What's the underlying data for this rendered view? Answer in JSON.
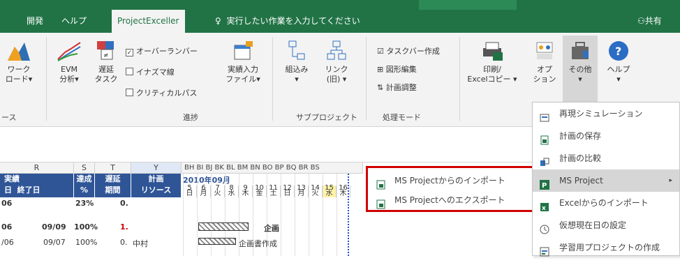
{
  "tabs": [
    "開発",
    "ヘルプ",
    "ProjectExceller"
  ],
  "tell_me": "実行したい作業を入力してください",
  "share": "共有",
  "ribbon": {
    "workload": [
      "ワーク",
      "ロード"
    ],
    "group_left": "ース",
    "evm": [
      "EVM",
      "分析"
    ],
    "delay": [
      "遅延",
      "タスク"
    ],
    "chk_overrun": "オーバーランバー",
    "chk_lightning": "イナズマ線",
    "chk_critical": "クリティカルパス",
    "group_progress": "進捗",
    "actual_input": [
      "実績入力",
      "ファイル"
    ],
    "embed": "組込み",
    "link": [
      "リンク",
      "(旧)"
    ],
    "group_subproject": "サブプロジェクト",
    "taskbar_create": "タスクバー作成",
    "shape_edit": "図形編集",
    "plan_adjust": "計画調整",
    "group_mode": "処理モード",
    "print": [
      "印刷/",
      "Excelコピー"
    ],
    "options": [
      "オプ",
      "ション"
    ],
    "other": "その他",
    "help": "ヘルプ"
  },
  "sheet": {
    "cols": [
      "R",
      "S",
      "T",
      "Y"
    ],
    "col_letters": "BH BI BJ BK BL BM BN BO BP BQ BR BS",
    "h_actual": "実績",
    "h_day": "日",
    "h_end": "終了日",
    "h_achieve": [
      "達成",
      "%"
    ],
    "h_delay": [
      "遅延",
      "期間"
    ],
    "h_plan": [
      "計画",
      "リソース"
    ],
    "month": "2010年09月",
    "days": [
      "5",
      "6",
      "7",
      "8",
      "9",
      "10",
      "11",
      "12",
      "13",
      "14",
      "15",
      "16"
    ],
    "weekdays": [
      "日",
      "月",
      "火",
      "水",
      "木",
      "金",
      "土",
      "日",
      "月",
      "火",
      "水",
      "木"
    ],
    "row1": {
      "a": "06",
      "pct": "23%",
      "delay": "0."
    },
    "row2": {
      "a": "06",
      "end": "09/09",
      "pct": "100%",
      "delay": "1.",
      "task": "企画"
    },
    "row3": {
      "a": "/06",
      "end": "09/07",
      "pct": "100%",
      "delay": "0.",
      "res": "中村",
      "task": "企画書作成"
    }
  },
  "submenu": {
    "import": "MS Projectからのインポート",
    "export": "MS Projectへのエクスポート"
  },
  "menu": {
    "items": [
      "再現シミュレーション",
      "計画の保存",
      "計画の比較",
      "MS Project",
      "Excelからのインポート",
      "仮想現在日の設定",
      "学習用プロジェクトの作成"
    ]
  },
  "colors": {
    "accent": "#217346",
    "highlight_border": "#d00000",
    "header_blue": "#2f5597"
  }
}
